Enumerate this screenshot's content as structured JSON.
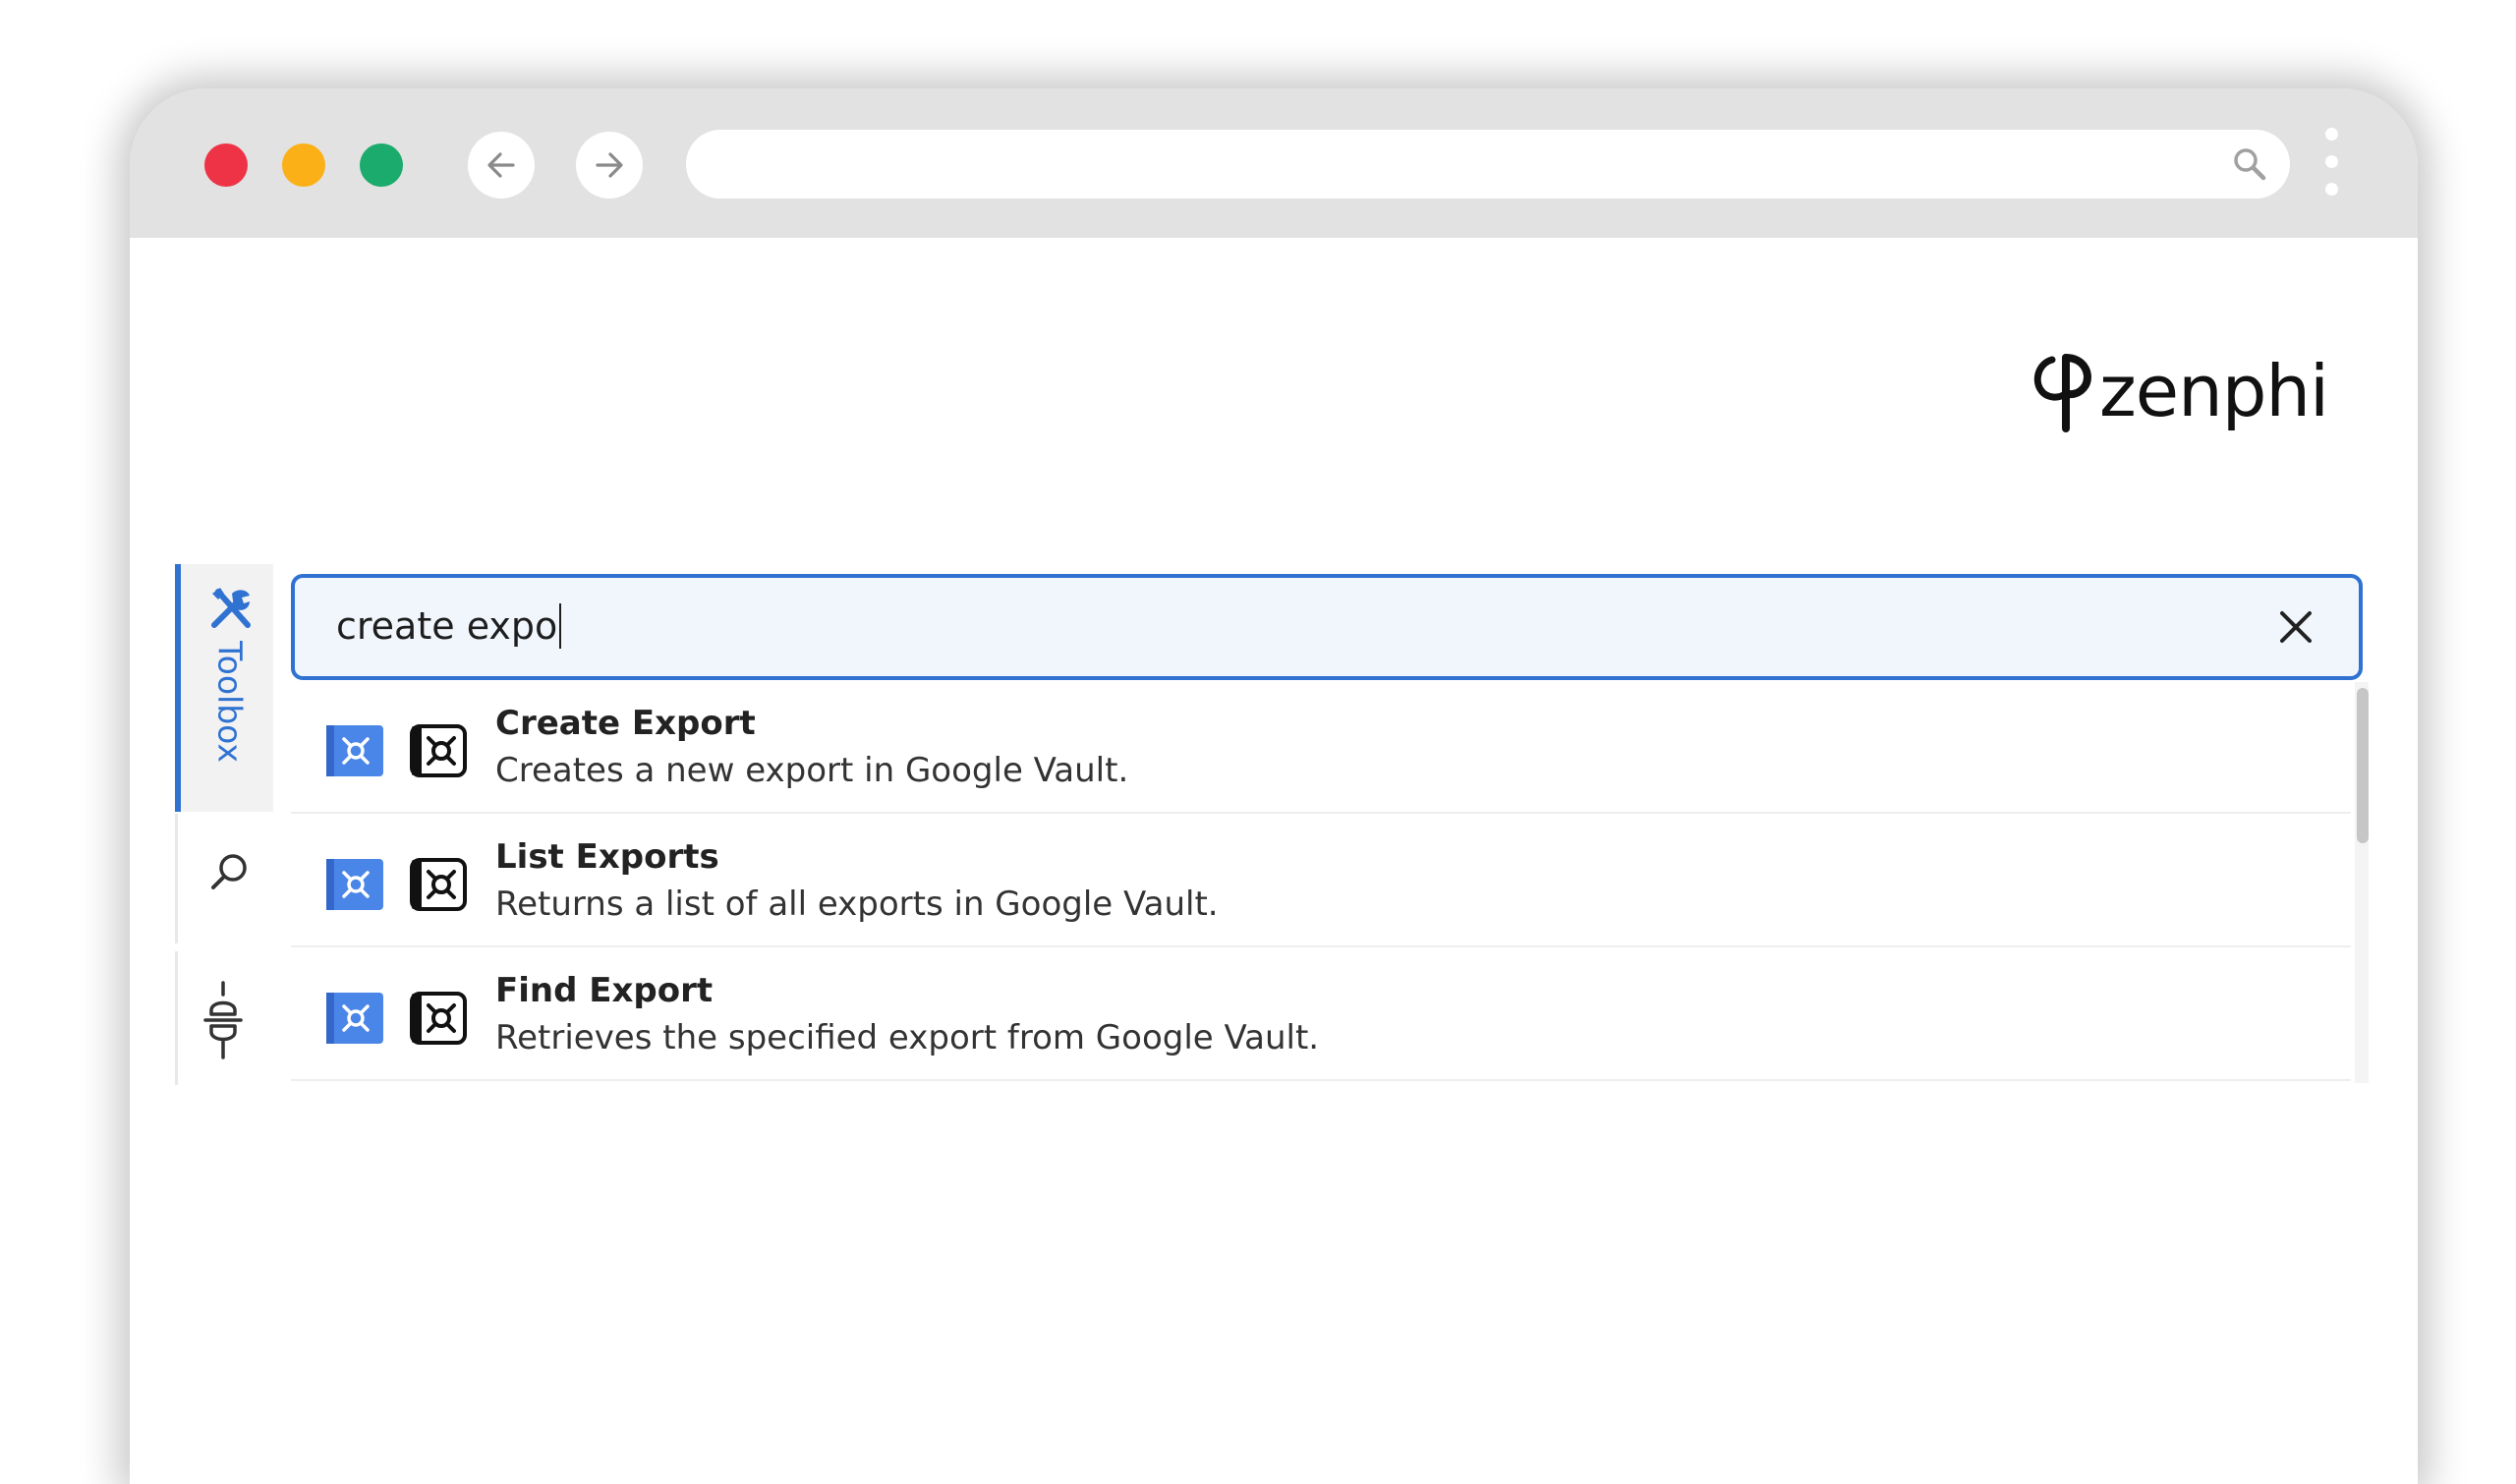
{
  "colors": {
    "close": "#ee3347",
    "minimize": "#fbb017",
    "maximize": "#1bab6c",
    "accent": "#2f72d2",
    "titlebar": "#e2e2e2"
  },
  "browser": {
    "url": ""
  },
  "brand": {
    "name": "zenphi"
  },
  "sidebar": {
    "toolbox_label": "Toolbox"
  },
  "search": {
    "query": "create expo"
  },
  "results": [
    {
      "title": "Create Export",
      "description": "Creates a new export in Google Vault."
    },
    {
      "title": "List Exports",
      "description": "Returns a list of all exports in Google Vault."
    },
    {
      "title": "Find Export",
      "description": "Retrieves the specified export from Google Vault."
    }
  ]
}
